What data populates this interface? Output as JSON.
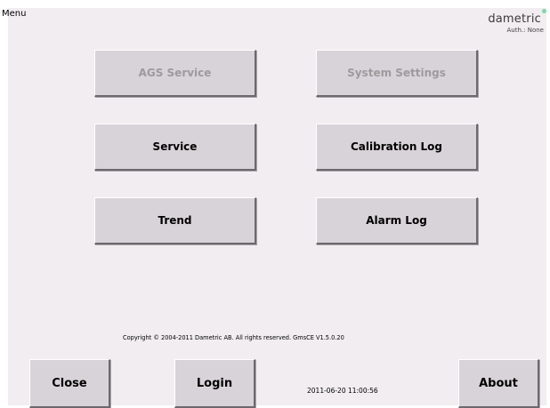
{
  "header": {
    "menu_label": "Menu",
    "brand_name": "dametric",
    "auth_text": "Auth.: None",
    "brand_dot_color": "#7fd7a6"
  },
  "menu_buttons": {
    "ags_service": "AGS Service",
    "system_settings": "System Settings",
    "service": "Service",
    "calibration_log": "Calibration Log",
    "trend": "Trend",
    "alarm_log": "Alarm Log"
  },
  "footer": {
    "copyright": "Copyright © 2004-2011 Dametric AB.  All rights reserved.  GmsCE V1.5.0.20",
    "close_label": "Close",
    "login_label": "Login",
    "about_label": "About",
    "datetime": "2011-06-20 11:00:56"
  },
  "colors": {
    "background": "#f1edf1",
    "button_face": "#d8d3d8",
    "disabled_text": "#9d9a9d"
  }
}
